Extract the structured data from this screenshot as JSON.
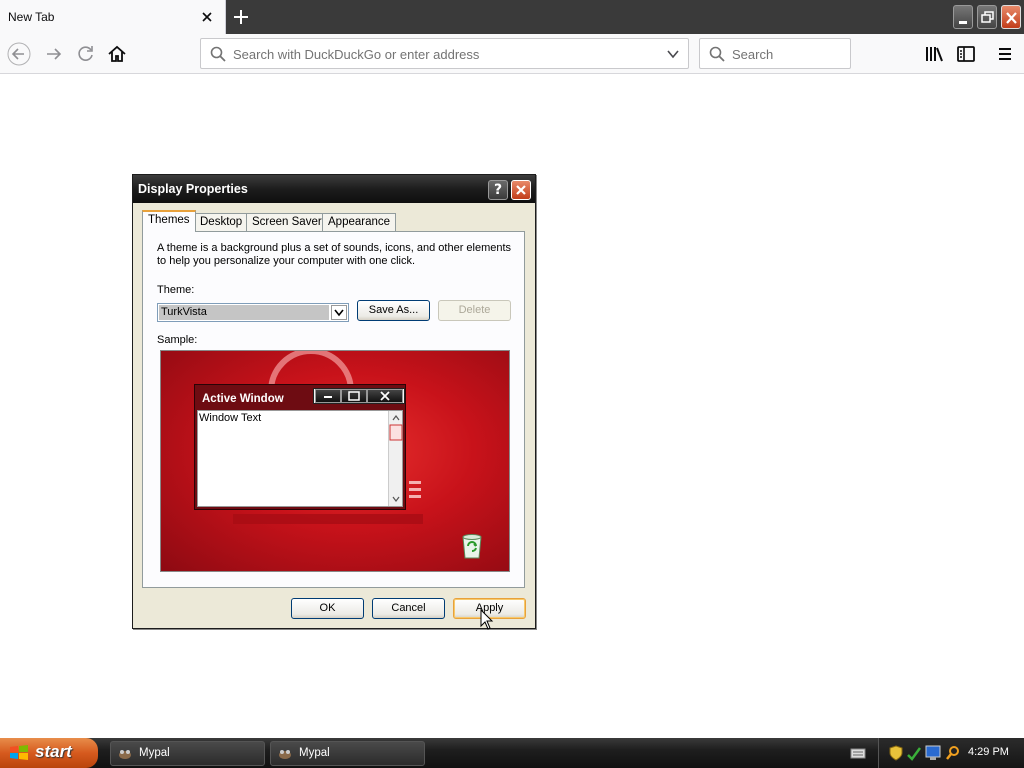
{
  "browser": {
    "tab_title": "New Tab",
    "url_placeholder": "Search with DuckDuckGo or enter address",
    "search_placeholder": "Search"
  },
  "dialog": {
    "title": "Display Properties",
    "help_label": "?",
    "tabs": [
      "Themes",
      "Desktop",
      "Screen Saver",
      "Appearance"
    ],
    "active_tab": "Themes",
    "description": "A theme is a background plus a set of sounds, icons, and other elements to help you personalize your computer with one click.",
    "theme_label": "Theme:",
    "theme_value": "TurkVista",
    "save_as_label": "Save As...",
    "delete_label": "Delete",
    "sample_label": "Sample:",
    "sample": {
      "active_window_title": "Active Window",
      "window_text": "Window Text"
    },
    "ok_label": "OK",
    "cancel_label": "Cancel",
    "apply_label": "Apply"
  },
  "taskbar": {
    "start_label": "start",
    "items": [
      "Mypal",
      "Mypal"
    ],
    "clock": "4:29 PM"
  },
  "colors": {
    "dialog_bg": "#ece9d8",
    "titlebar": "#1d1d1d",
    "close_button": "#c23d1a",
    "sample_red": "#c8121a",
    "start_orange": "#d65a1e"
  }
}
